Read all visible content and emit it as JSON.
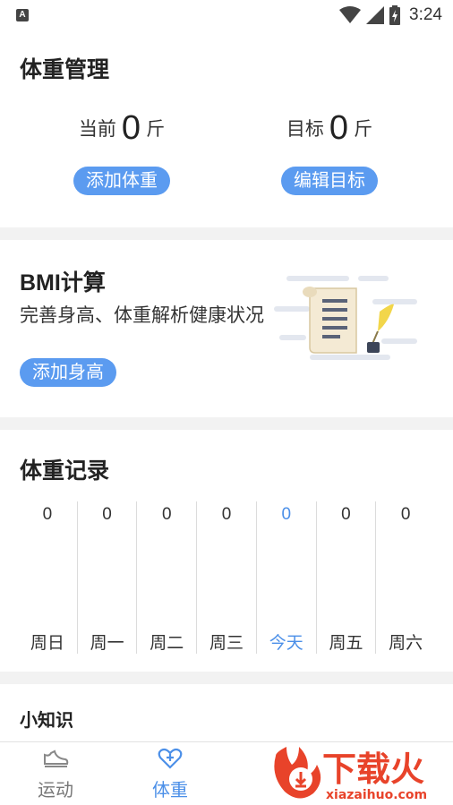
{
  "status_bar": {
    "notification_icon": "A",
    "time": "3:24"
  },
  "weight_management": {
    "title": "体重管理",
    "current_label": "当前",
    "current_value": "0",
    "current_unit": "斤",
    "add_weight_button": "添加体重",
    "target_label": "目标",
    "target_value": "0",
    "target_unit": "斤",
    "edit_target_button": "编辑目标"
  },
  "bmi": {
    "title": "BMI计算",
    "description": "完善身高、体重解析健康状况",
    "add_height_button": "添加身高"
  },
  "weight_records": {
    "title": "体重记录",
    "days": [
      {
        "label": "周日",
        "value": "0"
      },
      {
        "label": "周一",
        "value": "0"
      },
      {
        "label": "周二",
        "value": "0"
      },
      {
        "label": "周三",
        "value": "0"
      },
      {
        "label": "今天",
        "value": "0"
      },
      {
        "label": "周五",
        "value": "0"
      },
      {
        "label": "周六",
        "value": "0"
      }
    ],
    "today_index": 4
  },
  "tips": {
    "title": "小知识"
  },
  "bottom_nav": {
    "items": [
      {
        "label": "运动",
        "icon": "sneaker-icon"
      },
      {
        "label": "体重",
        "icon": "heart-plus-icon"
      }
    ],
    "active_index": 1
  },
  "watermark": {
    "brand": "下载火",
    "url": "xiazaihuo.com"
  },
  "colors": {
    "accent": "#5b9bf0",
    "today_text": "#4b8fe8",
    "watermark_red": "#e8432a"
  }
}
